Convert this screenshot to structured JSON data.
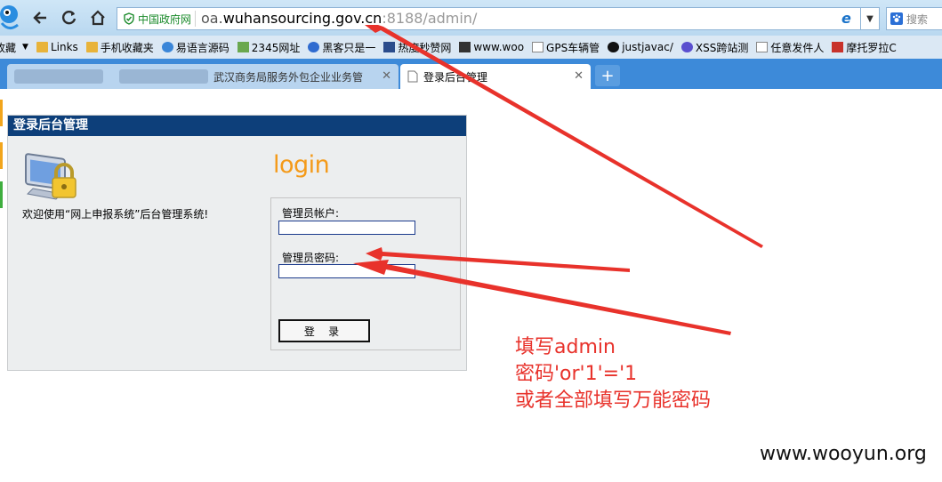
{
  "browser": {
    "address_bar": {
      "cert_label": "中国政府网",
      "url_prefix": "oa.",
      "url_host": "wuhansourcing.gov.cn",
      "url_rest": ":8188/admin/"
    },
    "search_placeholder": "搜索",
    "favorites": [
      "收藏",
      "Links",
      "手机收藏夹",
      "易语言源码",
      "2345网址",
      "黑客只是一",
      "热度秒赞网",
      "www.woo",
      "GPS车辆管",
      "justjavac/",
      "XSS跨站测",
      "任意发件人",
      "摩托罗拉C"
    ],
    "tabs": [
      {
        "label": "武汉商务局服务外包企业业务管",
        "active": false
      },
      {
        "label": "登录后台管理",
        "active": true
      }
    ],
    "new_tab_symbol": "+"
  },
  "page": {
    "panel_title": "登录后台管理",
    "login_word": "login",
    "welcome_text": "欢迎使用“网上申报系统”后台管理系统!",
    "username_label": "管理员帐户:",
    "password_label": "管理员密码:",
    "username_value": "",
    "password_value": "",
    "submit_label": "登 录"
  },
  "annotation": {
    "lines": [
      "填写admin",
      "密码'or'1'='1",
      "或者全部填写万能密码"
    ],
    "color": "#e8322b"
  },
  "watermark": "www.wooyun.org",
  "colors": {
    "panel_header": "#0d3f7a",
    "login_word": "#f49a19",
    "tab_bar": "#3d8ad9",
    "arrow": "#e8322b"
  }
}
